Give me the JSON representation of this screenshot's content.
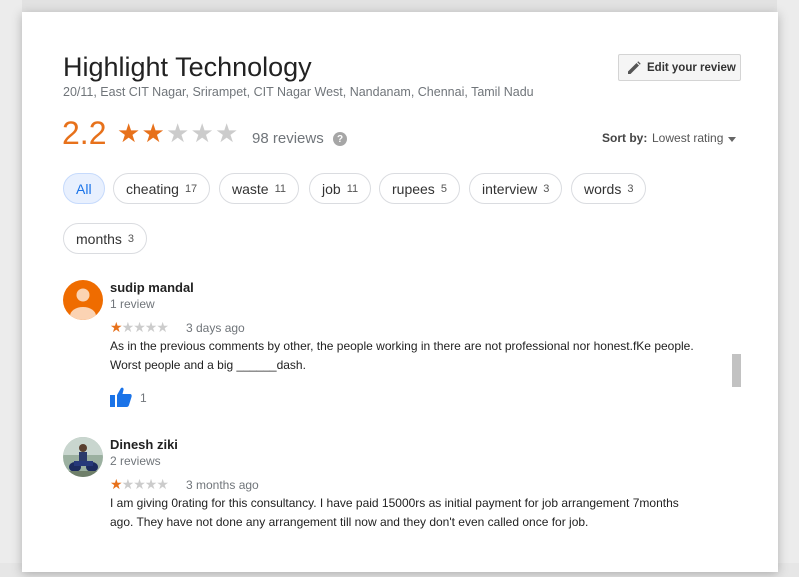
{
  "place": {
    "name": "Highlight Technology",
    "address": "20/11, East CIT Nagar, Srirampet, CIT Nagar West, Nandanam, Chennai, Tamil Nadu"
  },
  "edit_review_button": {
    "label": "Edit your review",
    "icon": "pencil-icon"
  },
  "summary": {
    "rating": "2.2",
    "stars_filled": 2,
    "stars_total": 5,
    "reviews_label": "98 reviews",
    "help_icon": "?"
  },
  "sort": {
    "label": "Sort by:",
    "value": "Lowest rating"
  },
  "filters": [
    {
      "label": "All",
      "count": ""
    },
    {
      "label": "cheating",
      "count": "17"
    },
    {
      "label": "waste",
      "count": "11"
    },
    {
      "label": "job",
      "count": "11"
    },
    {
      "label": "rupees",
      "count": "5"
    },
    {
      "label": "interview",
      "count": "3"
    },
    {
      "label": "words",
      "count": "3"
    },
    {
      "label": "months",
      "count": "3"
    }
  ],
  "reviews": [
    {
      "name": "sudip mandal",
      "meta": "1 review",
      "stars": 1,
      "date": "3 days ago",
      "text": "As in the previous comments by other, the people working in there are not professional nor honest.fKe people. Worst people and a big ______dash.",
      "likes": "1"
    },
    {
      "name": "Dinesh ziki",
      "meta": "2 reviews",
      "stars": 1,
      "date": "3 months ago",
      "text": "I am giving 0rating for this consultancy.  I have paid 15000rs as initial payment for job arrangement 7months ago. They have not done any arrangement till now and they don't even called once for job."
    }
  ],
  "colors": {
    "accent_orange": "#e7711b",
    "like_blue": "#1a73e8",
    "avatar_orange": "#ef6c00"
  }
}
